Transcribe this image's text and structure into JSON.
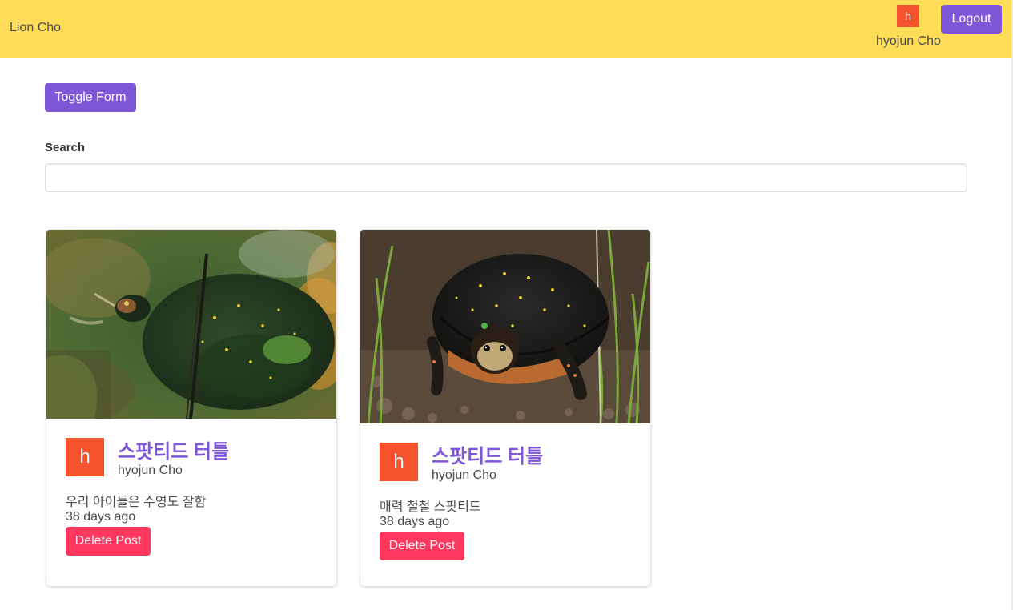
{
  "navbar": {
    "brand": "Lion Cho",
    "user_avatar_letter": "h",
    "user_name": "hyojun Cho",
    "logout_label": "Logout"
  },
  "toolbar": {
    "toggle_label": "Toggle Form"
  },
  "search": {
    "label": "Search",
    "value": "",
    "placeholder": ""
  },
  "posts": [
    {
      "image": "turtle-swimming-photo",
      "avatar_letter": "h",
      "title": "스팟티드 터틀",
      "author": "hyojun Cho",
      "body": "우리 아이들은 수영도 잘함",
      "time": "38 days ago",
      "delete_label": "Delete Post"
    },
    {
      "image": "spotted-turtle-on-ground-photo",
      "avatar_letter": "h",
      "title": "스팟티드 터틀",
      "author": "hyojun Cho",
      "body": "매력 철철 스팟티드",
      "time": "38 days ago",
      "delete_label": "Delete Post"
    }
  ],
  "colors": {
    "navbar": "#ffdd57",
    "primary": "#7e56d8",
    "avatar": "#f5522d",
    "danger": "#ff3860"
  }
}
